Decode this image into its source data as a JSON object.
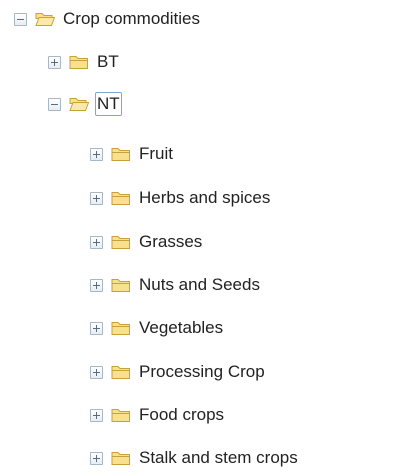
{
  "tree": {
    "root": {
      "label": "Crop commodities",
      "expanded": true,
      "icon": "folder-open-icon"
    },
    "bt": {
      "label": "BT",
      "expanded": false,
      "icon": "folder-icon"
    },
    "nt": {
      "label": "NT",
      "expanded": true,
      "selected": true,
      "icon": "folder-open-icon"
    },
    "nt_children": [
      {
        "label": "Fruit",
        "expanded": false,
        "icon": "folder-icon"
      },
      {
        "label": "Herbs and spices",
        "expanded": false,
        "icon": "folder-icon"
      },
      {
        "label": "Grasses",
        "expanded": false,
        "icon": "folder-icon"
      },
      {
        "label": "Nuts and Seeds",
        "expanded": false,
        "icon": "folder-icon"
      },
      {
        "label": "Vegetables",
        "expanded": false,
        "icon": "folder-icon"
      },
      {
        "label": "Processing Crop",
        "expanded": false,
        "icon": "folder-icon"
      },
      {
        "label": "Food crops",
        "expanded": false,
        "icon": "folder-icon"
      },
      {
        "label": "Stalk and stem crops",
        "expanded": false,
        "icon": "folder-icon"
      }
    ]
  },
  "colors": {
    "folder_fill": "#f8e08e",
    "folder_stroke": "#c9a13b",
    "selection_border": "#7fa6d8"
  }
}
